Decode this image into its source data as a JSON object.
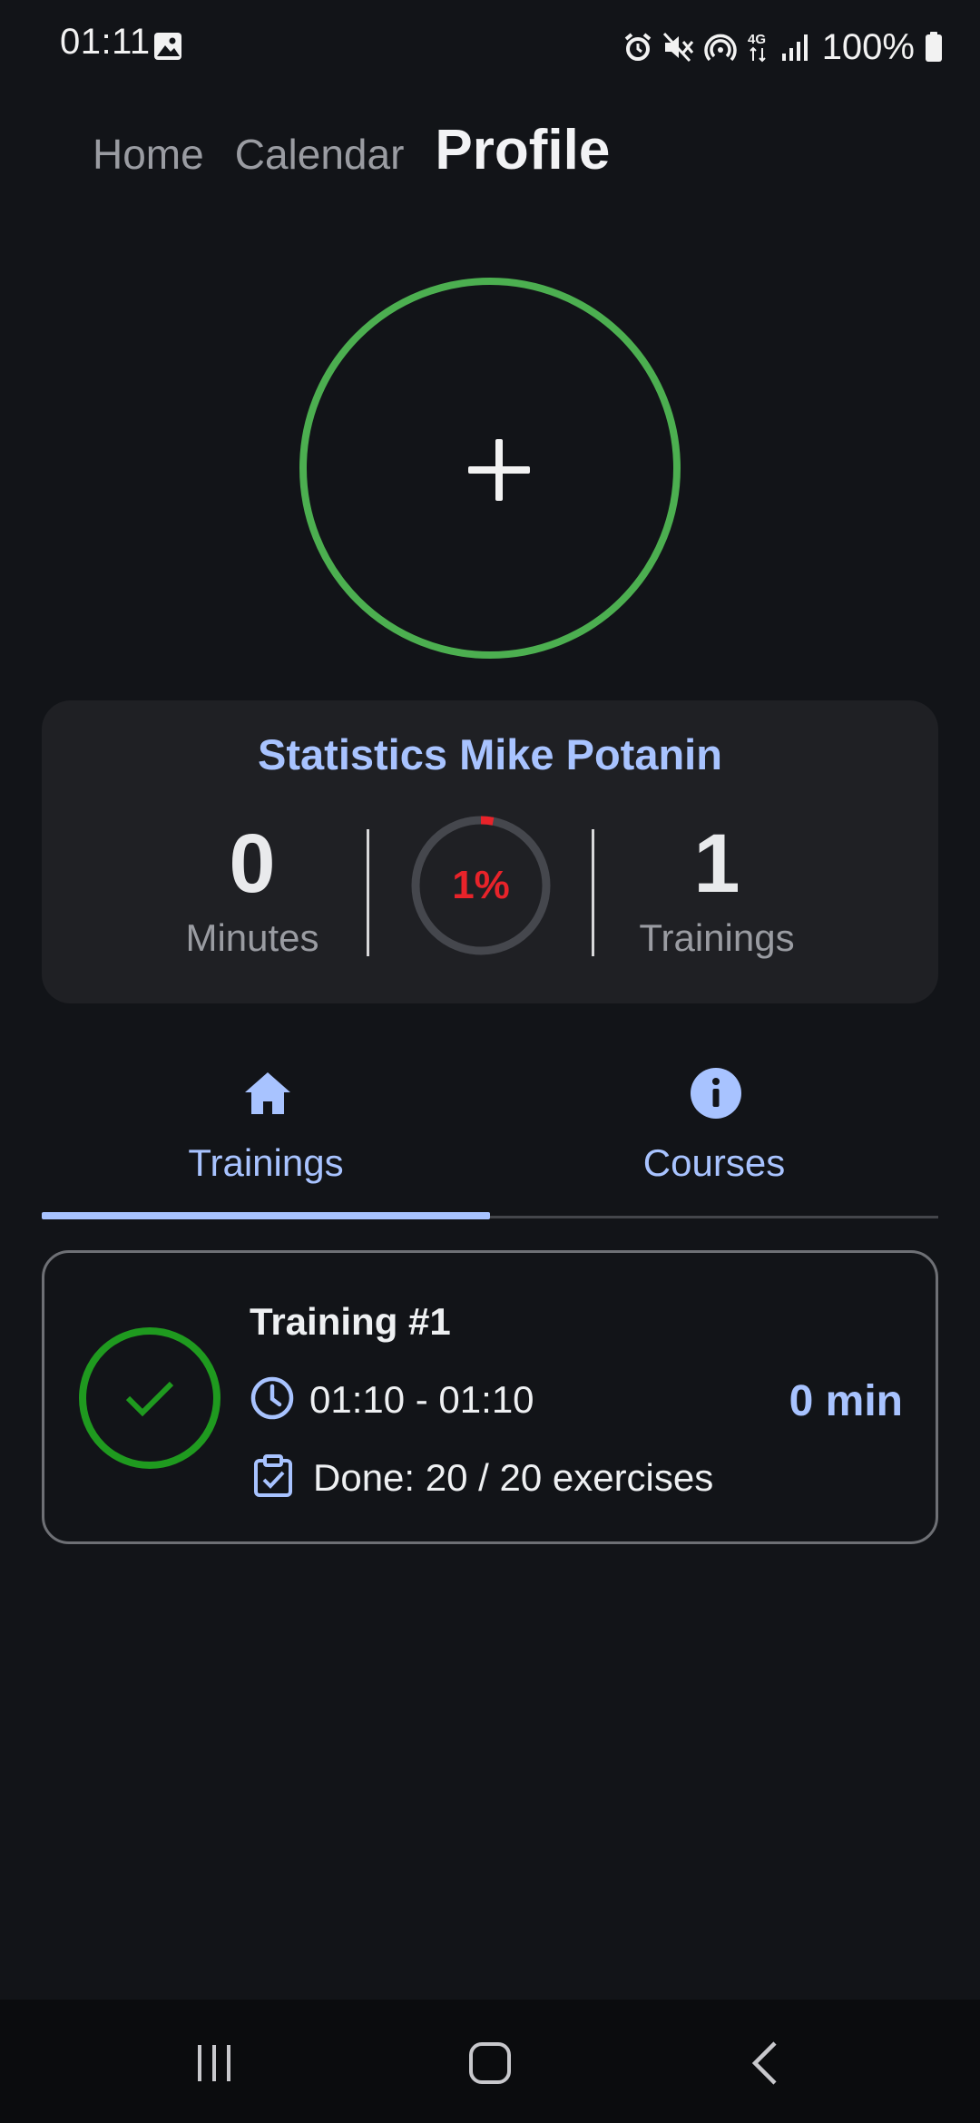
{
  "status_bar": {
    "time": "01:11",
    "battery": "100%",
    "network": "4G",
    "icons": [
      "gallery-icon",
      "alarm-icon",
      "mute-icon",
      "hotspot-icon",
      "network-4g-icon",
      "signal-icon",
      "battery-icon"
    ]
  },
  "top_nav": {
    "items": [
      {
        "label": "Home",
        "active": false
      },
      {
        "label": "Calendar",
        "active": false
      },
      {
        "label": "Profile",
        "active": true
      }
    ]
  },
  "avatar": {
    "icon": "plus-icon",
    "ring_color": "#4caf50"
  },
  "stats": {
    "title": "Statistics Mike Potanin",
    "minutes_value": "0",
    "minutes_label": "Minutes",
    "progress_text": "1%",
    "progress_fraction": 0.01,
    "trainings_value": "1",
    "trainings_label": "Trainings"
  },
  "tabs": [
    {
      "label": "Trainings",
      "icon": "home-icon",
      "selected": true
    },
    {
      "label": "Courses",
      "icon": "info-icon",
      "selected": false
    }
  ],
  "trainings": [
    {
      "title": "Training #1",
      "time_range": "01:10 - 01:10",
      "done_text": "Done: 20 / 20 exercises",
      "duration": "0 min",
      "status_icon": "check-icon"
    }
  ],
  "colors": {
    "accent": "#a8c3ff",
    "success": "#1f9a1f",
    "progress": "#e8232a",
    "background": "#121418",
    "card": "#1f2024"
  }
}
